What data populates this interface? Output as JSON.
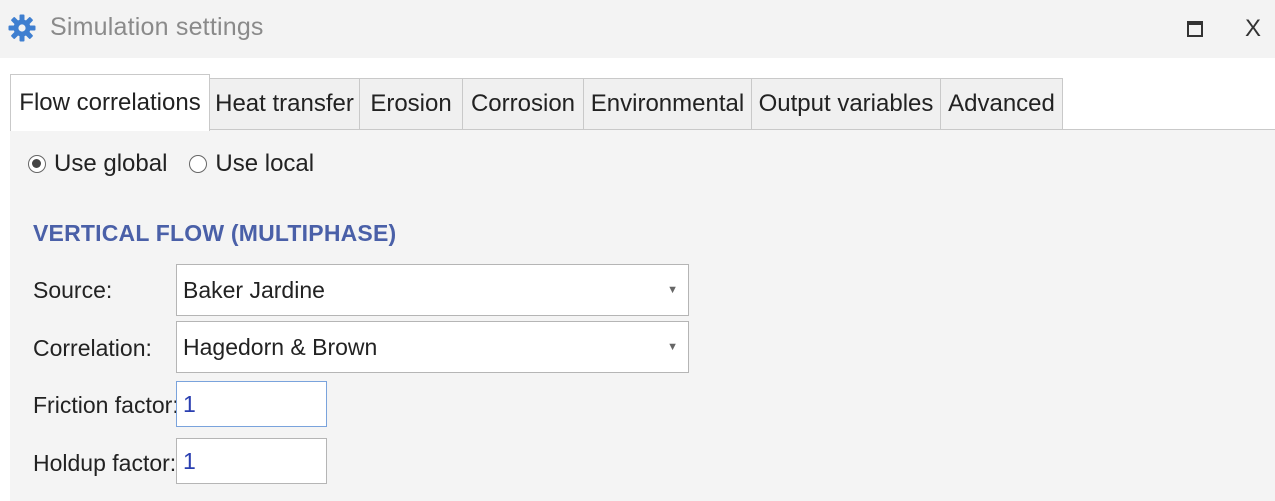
{
  "window": {
    "title": "Simulation settings",
    "icon": "gear-icon",
    "maximize_icon": "maximize-icon",
    "close_label": "X"
  },
  "tabs": [
    {
      "label": "Flow correlations",
      "active": true
    },
    {
      "label": "Heat transfer",
      "active": false
    },
    {
      "label": "Erosion",
      "active": false
    },
    {
      "label": "Corrosion",
      "active": false
    },
    {
      "label": "Environmental",
      "active": false
    },
    {
      "label": "Output variables",
      "active": false
    },
    {
      "label": "Advanced",
      "active": false
    }
  ],
  "scope": {
    "use_global": "Use global",
    "use_local": "Use local",
    "selected": "Use global"
  },
  "section": {
    "heading": "VERTICAL FLOW (MULTIPHASE)"
  },
  "fields": {
    "source": {
      "label": "Source:",
      "value": "Baker Jardine"
    },
    "correlation": {
      "label": "Correlation:",
      "value": "Hagedorn & Brown"
    },
    "friction_factor": {
      "label": "Friction factor:",
      "value": "1"
    },
    "holdup_factor": {
      "label": "Holdup factor:",
      "value": "1"
    }
  },
  "colors": {
    "accent": "#4a60a8",
    "icon": "#3f7fd0",
    "value_text": "#2a3fb0"
  }
}
